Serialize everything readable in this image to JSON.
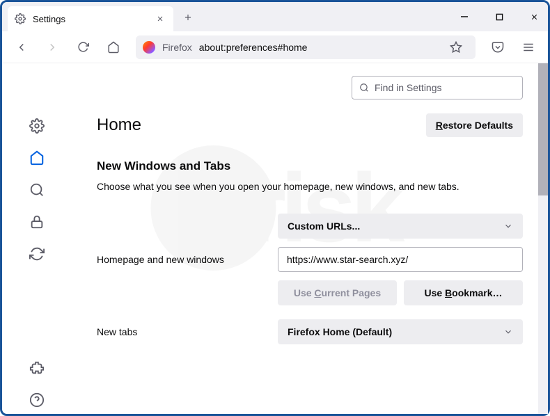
{
  "window": {
    "tab_title": "Settings",
    "url_prefix": "Firefox",
    "url_path": "about:preferences#home"
  },
  "search": {
    "placeholder": "Find in Settings"
  },
  "page": {
    "title": "Home",
    "restore_label": "Restore Defaults",
    "section_title": "New Windows and Tabs",
    "desc": "Choose what you see when you open your homepage, new windows, and new tabs."
  },
  "rows": {
    "homepage_label": "Homepage and new windows",
    "homepage_dropdown": "Custom URLs...",
    "homepage_url": "https://www.star-search.xyz/",
    "use_current": "Use Current Pages",
    "use_bookmark": "Use Bookmark…",
    "newtabs_label": "New tabs",
    "newtabs_dropdown": "Firefox Home (Default)"
  },
  "watermark": {
    "text": "risk"
  }
}
